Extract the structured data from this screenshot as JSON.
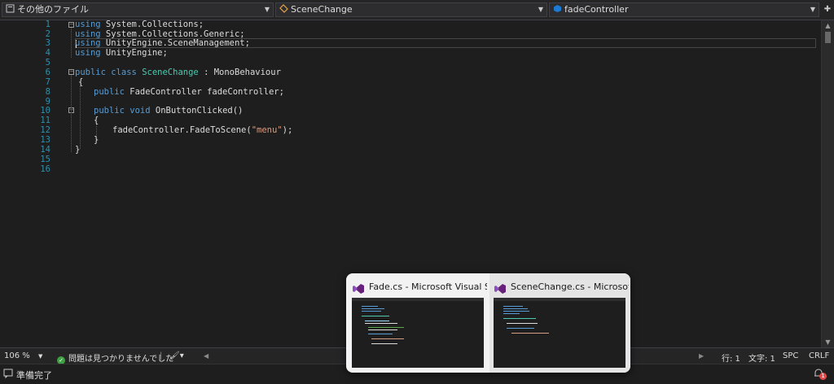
{
  "navbar": {
    "project": "その他のファイル",
    "class": "SceneChange",
    "member": "fadeController"
  },
  "code_lines": [
    {
      "n": "1",
      "t": "using System.Collections;"
    },
    {
      "n": "2",
      "t": "using System.Collections.Generic;"
    },
    {
      "n": "3",
      "t": "using UnityEngine.SceneManagement;"
    },
    {
      "n": "4",
      "t": "using UnityEngine;"
    },
    {
      "n": "5",
      "t": ""
    },
    {
      "n": "6",
      "t": "public class SceneChange : MonoBehaviour"
    },
    {
      "n": "7",
      "t": "{"
    },
    {
      "n": "8",
      "t": "    public FadeController fadeController;"
    },
    {
      "n": "9",
      "t": ""
    },
    {
      "n": "10",
      "t": "    public void OnButtonClicked()"
    },
    {
      "n": "11",
      "t": "    {"
    },
    {
      "n": "12",
      "t": "        fadeController.FadeToScene(\"menu\");"
    },
    {
      "n": "13",
      "t": "    }"
    },
    {
      "n": "14",
      "t": "}"
    },
    {
      "n": "15",
      "t": ""
    },
    {
      "n": "16",
      "t": ""
    }
  ],
  "code_parts": {
    "l1_kw": "using",
    "l1_rest": " System.Collections;",
    "l2_kw": "using",
    "l2_rest": " System.Collections.Generic;",
    "l3_kw": "using",
    "l3_rest": " UnityEngine.SceneManagement;",
    "l4_kw": "using",
    "l4_rest": " UnityEngine;",
    "l6_kw1": "public",
    "l6_kw2": "class",
    "l6_type": "SceneChange",
    "l6_rest": " : MonoBehaviour",
    "l7": "{",
    "l8_kw": "public",
    "l8_rest": " FadeController fadeController;",
    "l10_kw1": "public",
    "l10_kw2": "void",
    "l10_rest": " OnButtonClicked()",
    "l11": "{",
    "l12_a": "fadeController.FadeToScene(",
    "l12_str": "\"menu\"",
    "l12_b": ");",
    "l13": "}",
    "l14": "}"
  },
  "status": {
    "zoom": "106 %",
    "issues": "問題は見つかりませんでした",
    "line": "行: 1",
    "col": "文字: 1",
    "spacing": "SPC",
    "eol": "CRLF"
  },
  "bottom": {
    "ready": "準備完了",
    "notification_count": "1"
  },
  "taskbar_popup": {
    "windows": [
      {
        "title": "Fade.cs - Microsoft Visual Studio"
      },
      {
        "title": "SceneChange.cs - Microsoft Vis..."
      }
    ]
  },
  "colors": {
    "keyword": "#569cd6",
    "type": "#4ec9b0",
    "string": "#d69d85",
    "line_number": "#2b91af",
    "vs_purple": "#68217a"
  }
}
